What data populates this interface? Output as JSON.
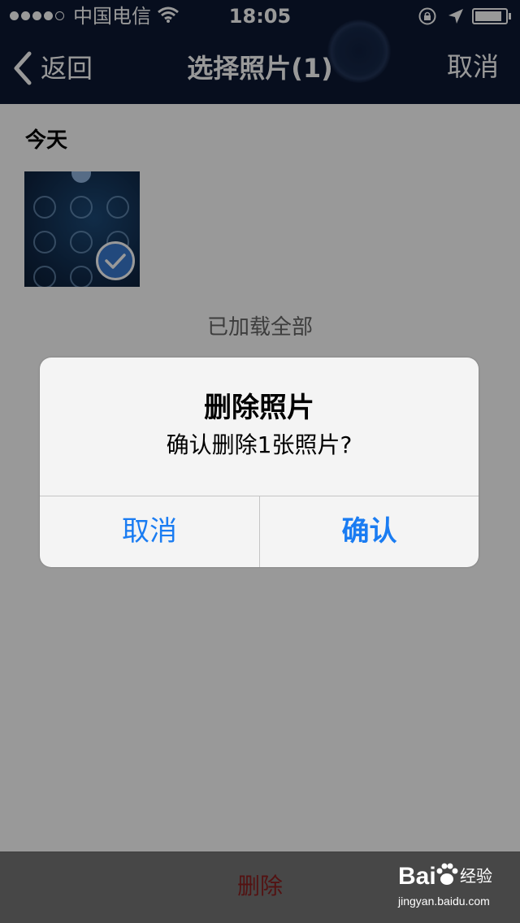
{
  "status_bar": {
    "carrier": "中国电信",
    "time": "18:05",
    "battery_level": 0.9,
    "icons": [
      "signal-icon",
      "wifi-icon",
      "rotation-lock-icon",
      "location-arrow-icon",
      "battery-icon"
    ]
  },
  "nav": {
    "back_label": "返回",
    "title": "选择照片(1)",
    "cancel_label": "取消",
    "back_icon": "chevron-left-icon"
  },
  "content": {
    "section_label": "今天",
    "selected_icon": "checkmark-icon",
    "loaded_text": "已加载全部"
  },
  "dialog": {
    "title": "删除照片",
    "message": "确认删除1张照片?",
    "cancel_label": "取消",
    "confirm_label": "确认"
  },
  "bottom_bar": {
    "delete_label": "删除"
  },
  "watermark": {
    "brand": "Bai",
    "suffix": "经验",
    "url": "jingyan.baidu.com"
  },
  "colors": {
    "nav_background": "#0c1833",
    "dialog_button": "#1a7cf2",
    "delete_text": "#8a1f1f",
    "selected_check": "#3a7ad0"
  }
}
